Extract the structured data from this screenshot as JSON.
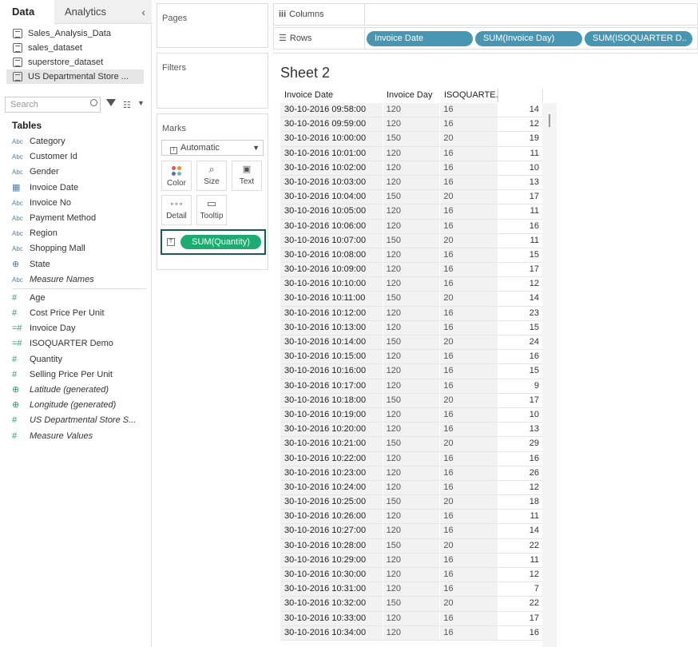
{
  "tabs": {
    "data": "Data",
    "analytics": "Analytics"
  },
  "data_sources": [
    "Sales_Analysis_Data",
    "sales_dataset",
    "superstore_dataset",
    "US Departmental Store ..."
  ],
  "search": {
    "placeholder": "Search"
  },
  "tables_heading": "Tables",
  "dimensions": [
    {
      "icon": "Abc",
      "label": "Category"
    },
    {
      "icon": "Abc",
      "label": "Customer Id"
    },
    {
      "icon": "Abc",
      "label": "Gender"
    },
    {
      "icon": "date",
      "label": "Invoice Date"
    },
    {
      "icon": "Abc",
      "label": "Invoice No"
    },
    {
      "icon": "Abc",
      "label": "Payment Method"
    },
    {
      "icon": "Abc",
      "label": "Region"
    },
    {
      "icon": "Abc",
      "label": "Shopping Mall"
    },
    {
      "icon": "geo",
      "label": "State"
    },
    {
      "icon": "Abc",
      "label": "Measure Names"
    }
  ],
  "measures": [
    {
      "icon": "#",
      "label": "Age"
    },
    {
      "icon": "#",
      "label": "Cost Price Per Unit"
    },
    {
      "icon": "=#",
      "label": "Invoice Day"
    },
    {
      "icon": "=#",
      "label": "ISOQUARTER Demo"
    },
    {
      "icon": "#",
      "label": "Quantity"
    },
    {
      "icon": "#",
      "label": "Selling Price Per Unit"
    },
    {
      "icon": "geo",
      "label": "Latitude (generated)"
    },
    {
      "icon": "geo",
      "label": "Longitude (generated)"
    },
    {
      "icon": "#",
      "label": "US Departmental Store S..."
    },
    {
      "icon": "#",
      "label": "Measure Values"
    }
  ],
  "shelves": {
    "pages": "Pages",
    "filters": "Filters",
    "marks": "Marks",
    "columns": "Columns",
    "rows": "Rows"
  },
  "marks": {
    "type": "Automatic",
    "color": "Color",
    "size": "Size",
    "text": "Text",
    "detail": "Detail",
    "tooltip": "Tooltip",
    "text_field": "SUM(Quantity)"
  },
  "row_pills": [
    "Invoice Date",
    "SUM(Invoice Day)",
    "SUM(ISOQUARTER D.."
  ],
  "sheet_title": "Sheet 2",
  "table_headers": [
    "Invoice Date",
    "Invoice Day",
    "ISOQUARTE.."
  ],
  "table_rows": [
    [
      "30-10-2016 09:58:00",
      "120",
      "16",
      "14"
    ],
    [
      "30-10-2016 09:59:00",
      "120",
      "16",
      "12"
    ],
    [
      "30-10-2016 10:00:00",
      "150",
      "20",
      "19"
    ],
    [
      "30-10-2016 10:01:00",
      "120",
      "16",
      "11"
    ],
    [
      "30-10-2016 10:02:00",
      "120",
      "16",
      "10"
    ],
    [
      "30-10-2016 10:03:00",
      "120",
      "16",
      "13"
    ],
    [
      "30-10-2016 10:04:00",
      "150",
      "20",
      "17"
    ],
    [
      "30-10-2016 10:05:00",
      "120",
      "16",
      "11"
    ],
    [
      "30-10-2016 10:06:00",
      "120",
      "16",
      "16"
    ],
    [
      "30-10-2016 10:07:00",
      "150",
      "20",
      "11"
    ],
    [
      "30-10-2016 10:08:00",
      "120",
      "16",
      "15"
    ],
    [
      "30-10-2016 10:09:00",
      "120",
      "16",
      "17"
    ],
    [
      "30-10-2016 10:10:00",
      "120",
      "16",
      "12"
    ],
    [
      "30-10-2016 10:11:00",
      "150",
      "20",
      "14"
    ],
    [
      "30-10-2016 10:12:00",
      "120",
      "16",
      "23"
    ],
    [
      "30-10-2016 10:13:00",
      "120",
      "16",
      "15"
    ],
    [
      "30-10-2016 10:14:00",
      "150",
      "20",
      "24"
    ],
    [
      "30-10-2016 10:15:00",
      "120",
      "16",
      "16"
    ],
    [
      "30-10-2016 10:16:00",
      "120",
      "16",
      "15"
    ],
    [
      "30-10-2016 10:17:00",
      "120",
      "16",
      "9"
    ],
    [
      "30-10-2016 10:18:00",
      "150",
      "20",
      "17"
    ],
    [
      "30-10-2016 10:19:00",
      "120",
      "16",
      "10"
    ],
    [
      "30-10-2016 10:20:00",
      "120",
      "16",
      "13"
    ],
    [
      "30-10-2016 10:21:00",
      "150",
      "20",
      "29"
    ],
    [
      "30-10-2016 10:22:00",
      "120",
      "16",
      "16"
    ],
    [
      "30-10-2016 10:23:00",
      "120",
      "16",
      "26"
    ],
    [
      "30-10-2016 10:24:00",
      "120",
      "16",
      "12"
    ],
    [
      "30-10-2016 10:25:00",
      "150",
      "20",
      "18"
    ],
    [
      "30-10-2016 10:26:00",
      "120",
      "16",
      "11"
    ],
    [
      "30-10-2016 10:27:00",
      "120",
      "16",
      "14"
    ],
    [
      "30-10-2016 10:28:00",
      "150",
      "20",
      "22"
    ],
    [
      "30-10-2016 10:29:00",
      "120",
      "16",
      "11"
    ],
    [
      "30-10-2016 10:30:00",
      "120",
      "16",
      "12"
    ],
    [
      "30-10-2016 10:31:00",
      "120",
      "16",
      "7"
    ],
    [
      "30-10-2016 10:32:00",
      "150",
      "20",
      "22"
    ],
    [
      "30-10-2016 10:33:00",
      "120",
      "16",
      "17"
    ],
    [
      "30-10-2016 10:34:00",
      "120",
      "16",
      "16"
    ]
  ],
  "colors": {
    "pill_dimension": "#4996b2",
    "pill_measure": "#1cab70",
    "highlight_border": "#1a5a57"
  }
}
